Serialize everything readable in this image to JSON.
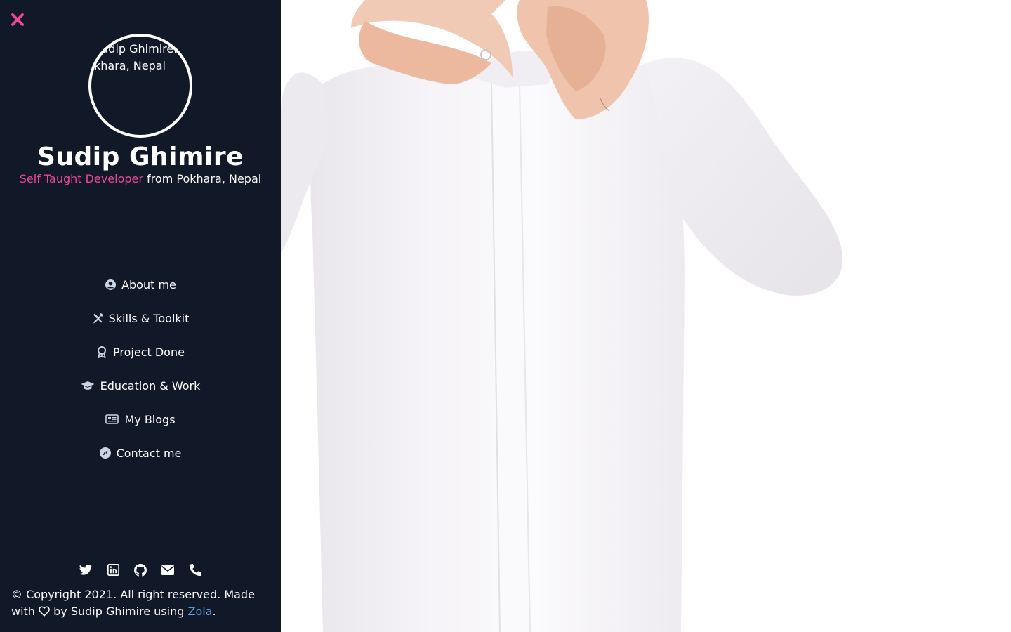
{
  "profile": {
    "avatar_alt": "Sudip GhimirefromPokhara, Nepal",
    "name": "Sudip Ghimire",
    "role": "Self Taught Developer",
    "location_text": " from Pokhara, Nepal"
  },
  "nav": {
    "items": [
      {
        "label": "About me",
        "icon": "user-circle-icon"
      },
      {
        "label": "Skills & Toolkit",
        "icon": "tools-icon"
      },
      {
        "label": "Project Done",
        "icon": "award-icon"
      },
      {
        "label": "Education & Work",
        "icon": "graduation-cap-icon"
      },
      {
        "label": "My Blogs",
        "icon": "newspaper-icon"
      },
      {
        "label": "Contact me",
        "icon": "compass-icon"
      }
    ]
  },
  "socials": [
    "twitter-icon",
    "linkedin-icon",
    "github-icon",
    "envelope-icon",
    "phone-icon"
  ],
  "footer": {
    "prefix": "© Copyright 2021. All right reserved. Made with",
    "middle": "by Sudip Ghimire using",
    "link": "Zola",
    "suffix": "."
  },
  "colors": {
    "sidebar_bg": "#111827",
    "accent_pink": "#ec4899",
    "link_blue": "#60a5fa"
  }
}
